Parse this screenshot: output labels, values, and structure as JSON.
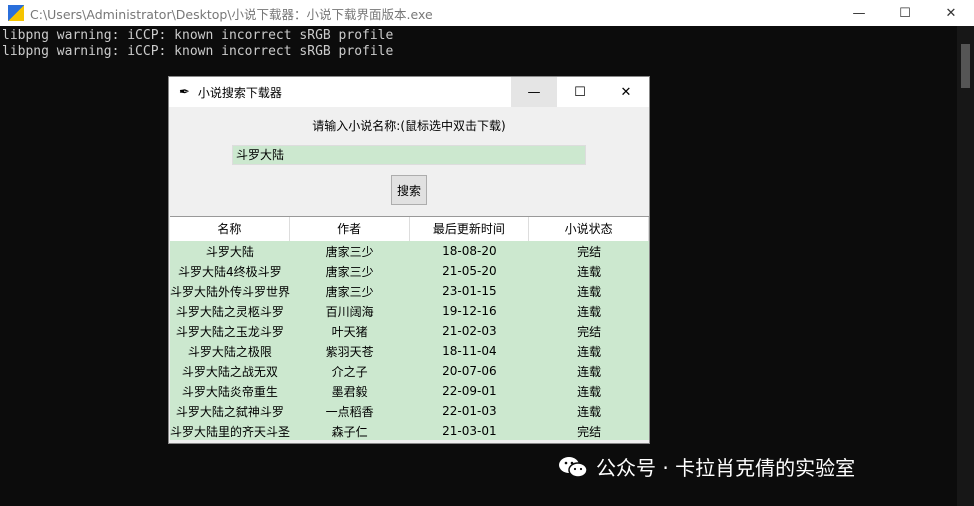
{
  "console_window": {
    "title": "C:\\Users\\Administrator\\Desktop\\小说下载器：小说下载界面版本.exe",
    "lines": [
      "libpng warning: iCCP: known incorrect sRGB profile",
      "libpng warning: iCCP: known incorrect sRGB profile"
    ]
  },
  "app": {
    "title": "小说搜索下载器",
    "prompt": "请输入小说名称:(鼠标选中双击下载)",
    "search_value": "斗罗大陆",
    "search_button": "搜索",
    "columns": [
      "名称",
      "作者",
      "最后更新时间",
      "小说状态"
    ],
    "rows": [
      [
        "斗罗大陆",
        "唐家三少",
        "18-08-20",
        "完结"
      ],
      [
        "斗罗大陆4终极斗罗",
        "唐家三少",
        "21-05-20",
        "连载"
      ],
      [
        "斗罗大陆外传斗罗世界",
        "唐家三少",
        "23-01-15",
        "连载"
      ],
      [
        "斗罗大陆之灵柩斗罗",
        "百川阔海",
        "19-12-16",
        "连载"
      ],
      [
        "斗罗大陆之玉龙斗罗",
        "叶天猪",
        "21-02-03",
        "完结"
      ],
      [
        "斗罗大陆之极限",
        "紫羽天苍",
        "18-11-04",
        "连载"
      ],
      [
        "斗罗大陆之战无双",
        "介之子",
        "20-07-06",
        "连载"
      ],
      [
        "斗罗大陆炎帝重生",
        "墨君毅",
        "22-09-01",
        "连载"
      ],
      [
        "斗罗大陆之弑神斗罗",
        "一点稻香",
        "22-01-03",
        "连载"
      ],
      [
        "斗罗大陆里的齐天斗圣",
        "森子仁",
        "21-03-01",
        "完结"
      ]
    ]
  },
  "watermark": "公众号 · 卡拉肖克倩的实验室"
}
